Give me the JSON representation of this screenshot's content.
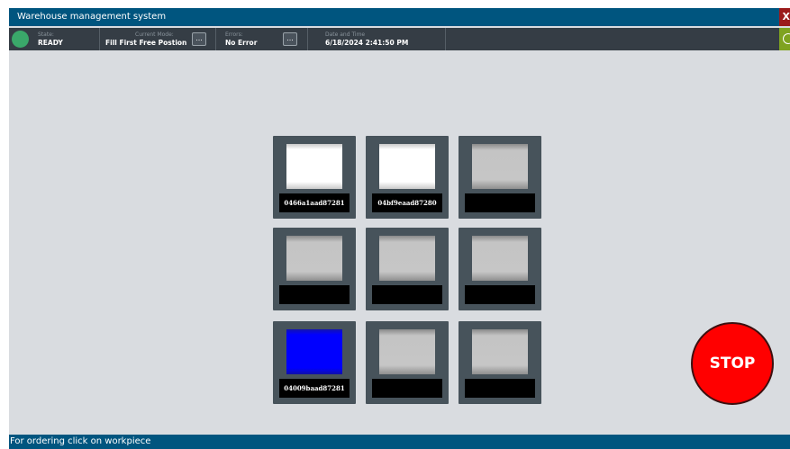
{
  "window": {
    "title": "Warehouse management system",
    "close_label": "X"
  },
  "status": {
    "state_caption": "State:",
    "state_value": "READY",
    "mode_caption": "Current Mode:",
    "mode_value": "Fill First Free Postion",
    "mode_more": "...",
    "errors_caption": "Errors:",
    "errors_value": "No Error",
    "errors_more": "...",
    "datetime_caption": "Date and Time",
    "datetime_value": "6/18/2024 2:41:50 PM"
  },
  "colors": {
    "title_bar": "#00557f",
    "status_bar": "#353d45",
    "background": "#d9dce0",
    "state_ready": "#3aa86a",
    "stop": "#ff0000",
    "close": "#9b1b1b",
    "confirm": "#7fa320"
  },
  "grid": {
    "cells": [
      {
        "color": "white",
        "label": "0466a1aad87281"
      },
      {
        "color": "white",
        "label": "04bf9eaad87280"
      },
      {
        "color": "empty",
        "label": ""
      },
      {
        "color": "empty",
        "label": ""
      },
      {
        "color": "empty",
        "label": ""
      },
      {
        "color": "empty",
        "label": ""
      },
      {
        "color": "blue",
        "label": "04009baad87281"
      },
      {
        "color": "empty",
        "label": ""
      },
      {
        "color": "empty",
        "label": ""
      }
    ]
  },
  "stop_label": "STOP",
  "footer": {
    "hint": "For ordering click on workpiece"
  }
}
